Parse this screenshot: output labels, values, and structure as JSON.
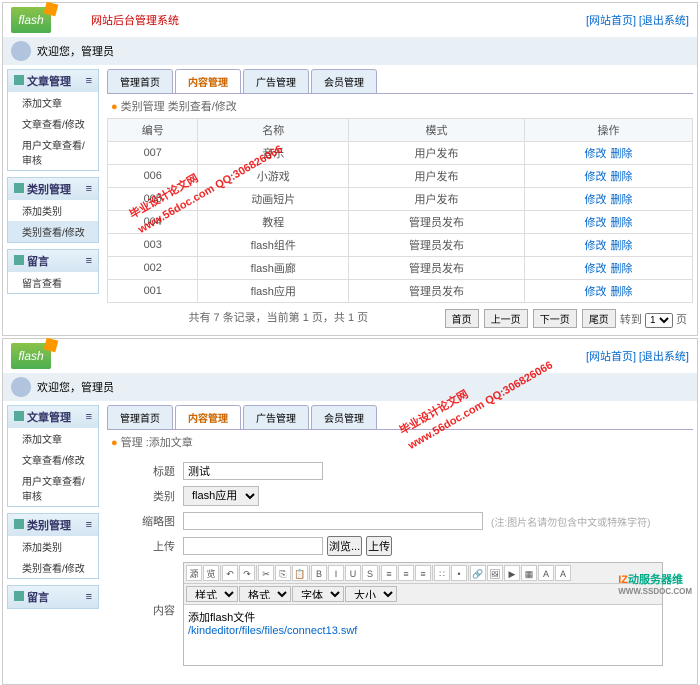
{
  "logo": "flash",
  "system_title": "网站后台管理系统",
  "header_links": {
    "home": "[网站首页]",
    "logout": "[退出系统]"
  },
  "welcome": {
    "prefix": "欢迎您，",
    "user": "管理员"
  },
  "sidebar": {
    "groups": [
      {
        "title": "文章管理",
        "collapse": "≡",
        "items": [
          "添加文章",
          "文章查看/修改",
          "用户文章查看/审核"
        ]
      },
      {
        "title": "类别管理",
        "collapse": "≡",
        "items": [
          "添加类别",
          "类别查看/修改"
        ],
        "active_index": 1
      },
      {
        "title": "留言",
        "collapse": "≡",
        "items": [
          "留言查看"
        ]
      }
    ]
  },
  "sidebar2": {
    "groups": [
      {
        "title": "文章管理",
        "collapse": "≡",
        "items": [
          "添加文章",
          "文章查看/修改",
          "用户文章查看/审核"
        ]
      },
      {
        "title": "类别管理",
        "collapse": "≡",
        "items": [
          "添加类别",
          "类别查看/修改"
        ]
      },
      {
        "title": "留言",
        "collapse": "≡",
        "items": []
      }
    ]
  },
  "tabs": [
    "管理首页",
    "内容管理",
    "广告管理",
    "会员管理"
  ],
  "active_tab": 1,
  "crumb1": "类别管理 类别查看/修改",
  "crumb2": "管理 :添加文章",
  "table": {
    "headers": [
      "编号",
      "名称",
      "模式",
      "操作"
    ],
    "rows": [
      {
        "id": "007",
        "name": "音乐",
        "mode": "用户发布",
        "ops": [
          "修改",
          "删除"
        ]
      },
      {
        "id": "006",
        "name": "小游戏",
        "mode": "用户发布",
        "ops": [
          "修改",
          "删除"
        ]
      },
      {
        "id": "005",
        "name": "动画短片",
        "mode": "用户发布",
        "ops": [
          "修改",
          "删除"
        ]
      },
      {
        "id": "004",
        "name": "教程",
        "mode": "管理员发布",
        "ops": [
          "修改",
          "删除"
        ]
      },
      {
        "id": "003",
        "name": "flash组件",
        "mode": "管理员发布",
        "ops": [
          "修改",
          "删除"
        ]
      },
      {
        "id": "002",
        "name": "flash画廊",
        "mode": "管理员发布",
        "ops": [
          "修改",
          "删除"
        ]
      },
      {
        "id": "001",
        "name": "flash应用",
        "mode": "管理员发布",
        "ops": [
          "修改",
          "删除"
        ]
      }
    ]
  },
  "pager": {
    "summary": "共有 7 条记录，当前第 1 页，共 1 页",
    "first": "首页",
    "prev": "上一页",
    "next": "下一页",
    "last": "尾页",
    "goto": "转到",
    "go": "页"
  },
  "form": {
    "title_label": "标题",
    "title_value": "测试",
    "cat_label": "类别",
    "cat_value": "flash应用",
    "thumb_label": "缩略图",
    "thumb_hint": "(注:图片名请勿包含中文或特殊字符)",
    "upload_label": "上传",
    "browse_btn": "浏览...",
    "upload_btn": "上传",
    "content_label": "内容",
    "editor_selects": [
      "样式",
      "格式",
      "字体",
      "大小"
    ],
    "editor_content": "添加flash文件",
    "editor_link": "/kindeditor/files/files/connect13.swf"
  },
  "watermark": {
    "line1": "毕业设计论文网",
    "line2": "www.56doc.com   QQ:306826066"
  },
  "footer": {
    "z": "IZ",
    "rest": "动服务器维",
    "sub": "WWW.SSDOC.COM"
  }
}
